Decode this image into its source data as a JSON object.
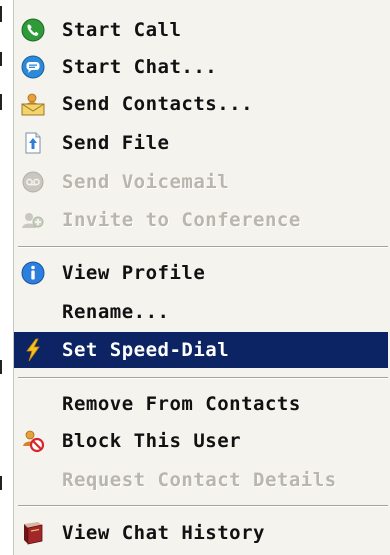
{
  "menu": {
    "items": [
      {
        "label": "Start Call",
        "icon": "phone-icon",
        "enabled": true
      },
      {
        "label": "Start Chat...",
        "icon": "chat-bubble-icon",
        "enabled": true
      },
      {
        "label": "Send Contacts...",
        "icon": "contacts-envelope-icon",
        "enabled": true
      },
      {
        "label": "Send File",
        "icon": "file-upload-icon",
        "enabled": true
      },
      {
        "label": "Send Voicemail",
        "icon": "voicemail-icon",
        "enabled": false
      },
      {
        "label": "Invite to Conference",
        "icon": "conference-icon",
        "enabled": false
      },
      {
        "label": "View Profile",
        "icon": "info-icon",
        "enabled": true
      },
      {
        "label": "Rename...",
        "icon": "",
        "enabled": true
      },
      {
        "label": "Set Speed-Dial",
        "icon": "lightning-icon",
        "enabled": true,
        "selected": true
      },
      {
        "label": "Remove From Contacts",
        "icon": "",
        "enabled": true
      },
      {
        "label": "Block This User",
        "icon": "block-user-icon",
        "enabled": true
      },
      {
        "label": "Request Contact Details",
        "icon": "",
        "enabled": false
      },
      {
        "label": "View Chat History",
        "icon": "history-book-icon",
        "enabled": true
      }
    ]
  },
  "colors": {
    "menu_background": "#f5f3ee",
    "selection": "#0c2463",
    "disabled_text": "#b9b6ad"
  }
}
